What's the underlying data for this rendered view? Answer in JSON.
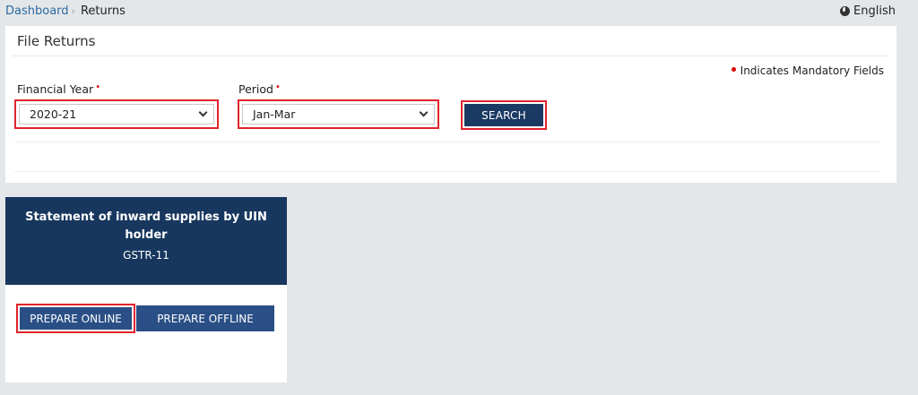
{
  "breadcrumb": {
    "link": "Dashboard",
    "separator": "›",
    "current": "Returns"
  },
  "language": {
    "icon": "globe-icon",
    "label": "English"
  },
  "file_returns": {
    "title": "File Returns",
    "mandatory_note": "Indicates Mandatory Fields",
    "financial_year": {
      "label": "Financial Year",
      "value": "2020-21"
    },
    "period": {
      "label": "Period",
      "value": "Jan-Mar"
    },
    "required_marker": "•",
    "search_label": "SEARCH"
  },
  "tile": {
    "title": "Statement of inward supplies by UIN holder",
    "form": "GSTR-11",
    "prepare_online": "PREPARE ONLINE",
    "prepare_offline": "PREPARE OFFLINE"
  },
  "colors": {
    "highlight": "#e0232b",
    "tile_header": "#17375e",
    "button": "#2a4f86",
    "link": "#2c6aa0"
  }
}
